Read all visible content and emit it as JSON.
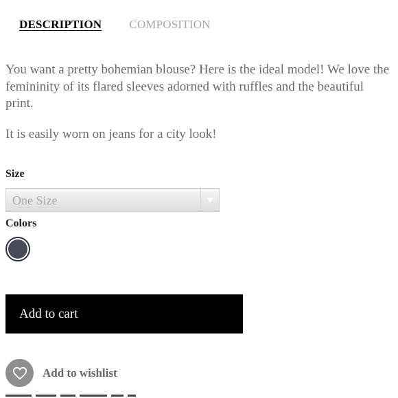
{
  "tabs": {
    "description": "DESCRIPTION",
    "composition": "COMPOSITION"
  },
  "description": {
    "paragraph1": "You want a pretty bohemian blouse? Here is the ideal model! We love the femininity of its flared sleeves adorned with ruffles and the beautiful print.",
    "paragraph2": "It is easily worn on jeans for a city look!"
  },
  "size": {
    "label": "Size",
    "selected": "One Size"
  },
  "colors": {
    "label": "Colors",
    "swatch_color": "#464c57"
  },
  "cart": {
    "label": "Add to cart"
  },
  "wishlist": {
    "label": "Add to wishlist",
    "icon": "heart-icon"
  }
}
